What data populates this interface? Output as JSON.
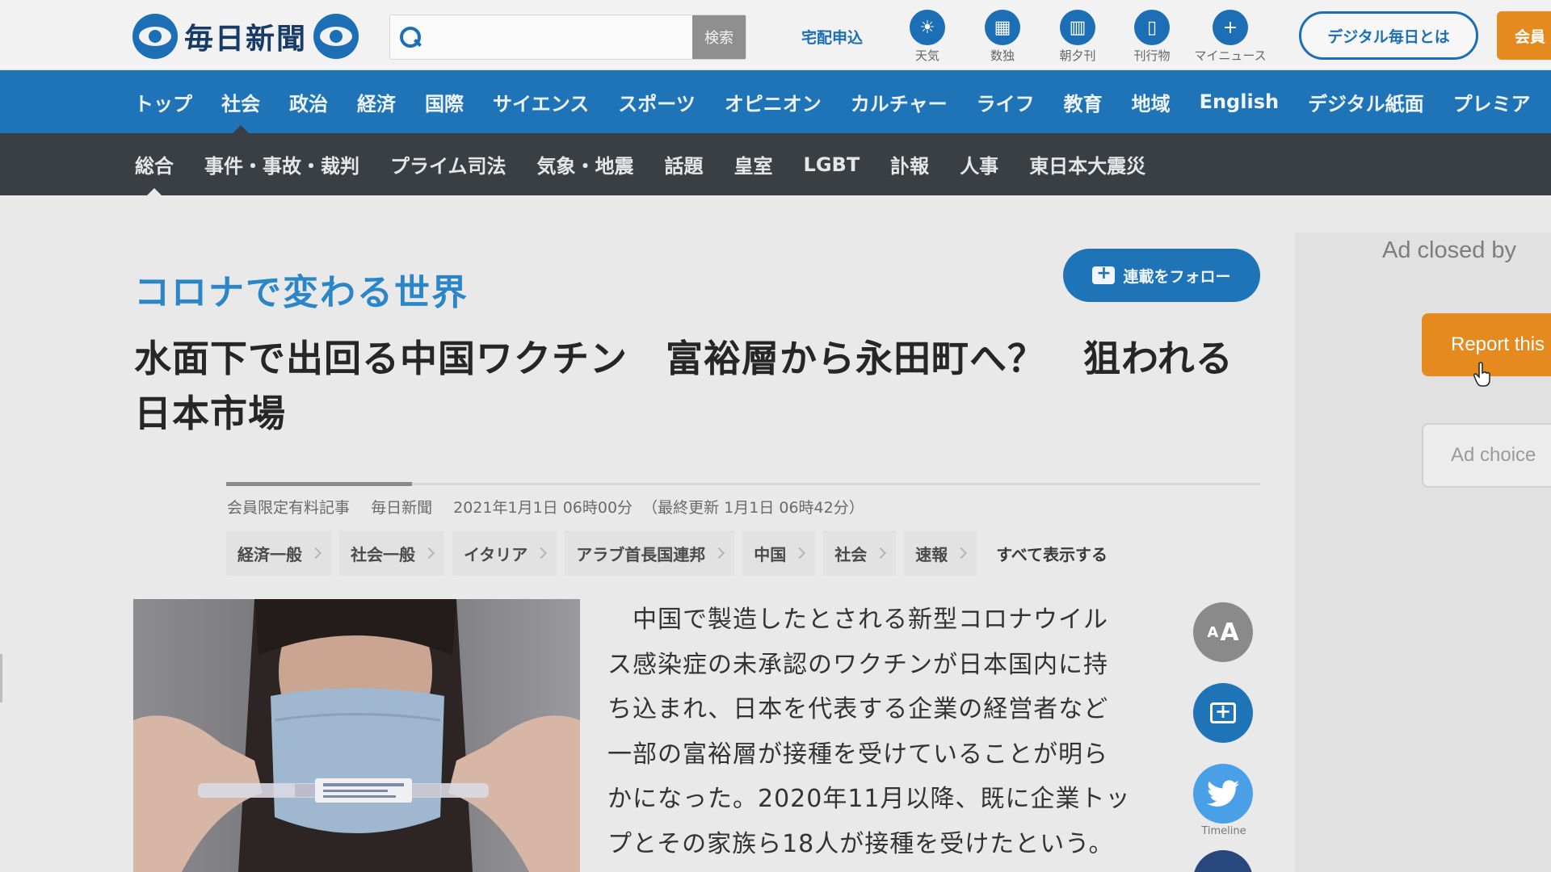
{
  "header": {
    "logo_text": "毎日新聞",
    "search_placeholder": "",
    "search_button": "検索",
    "delivery_link": "宅配申込",
    "icons": [
      {
        "label": "天気",
        "icon": "weather-icon"
      },
      {
        "label": "数独",
        "icon": "sudoku-icon"
      },
      {
        "label": "朝夕刊",
        "icon": "newspaper-icon"
      },
      {
        "label": "刊行物",
        "icon": "book-icon"
      },
      {
        "label": "マイニュース",
        "icon": "my-news-icon"
      }
    ],
    "digital_pill": "デジタル毎日とは",
    "member_button": "会員"
  },
  "main_nav": [
    "トップ",
    "社会",
    "政治",
    "経済",
    "国際",
    "サイエンス",
    "スポーツ",
    "オピニオン",
    "カルチャー",
    "ライフ",
    "教育",
    "地域",
    "English",
    "デジタル紙面",
    "プレミア"
  ],
  "sub_nav": [
    "総合",
    "事件・事故・裁判",
    "プライム司法",
    "気象・地震",
    "話題",
    "皇室",
    "LGBT",
    "訃報",
    "人事",
    "東日本大震災"
  ],
  "article": {
    "series": "コロナで変わる世界",
    "follow_button": "連載をフォロー",
    "headline_line1": "水面下で出回る中国ワクチン　富裕層から永田町へ？　狙われる",
    "headline_line2": "日本市場",
    "meta": {
      "type": "会員限定有料記事",
      "source": "毎日新聞",
      "published": "2021年1月1日 06時00分",
      "updated": "（最終更新 1月1日 06時42分）"
    },
    "tags": [
      "経済一般",
      "社会一般",
      "イタリア",
      "アラブ首長国連邦",
      "中国",
      "社会",
      "速報"
    ],
    "show_all": "すべて表示する",
    "body_lines": [
      "　中国で製造したとされる新型コロナウイル",
      "ス感染症の未承認のワクチンが日本国内に持",
      "ち込まれ、日本を代表する企業の経営者など",
      "一部の富裕層が接種を受けていることが明ら",
      "かになった。2020年11月以降、既に企業トッ",
      "プとその家族ら18人が接種を受けたという。"
    ],
    "share": {
      "font_size_label": "A",
      "font_size_label_small": "A",
      "timeline_label": "Timeline"
    }
  },
  "ad": {
    "closed_text": "Ad closed by",
    "report_button": "Report this",
    "choices_button": "Ad choice"
  },
  "colors": {
    "brand_blue": "#1f74b8",
    "subnav_dark": "#3a3f44",
    "accent_orange": "#e48a1f",
    "series_blue": "#2b86c7"
  }
}
